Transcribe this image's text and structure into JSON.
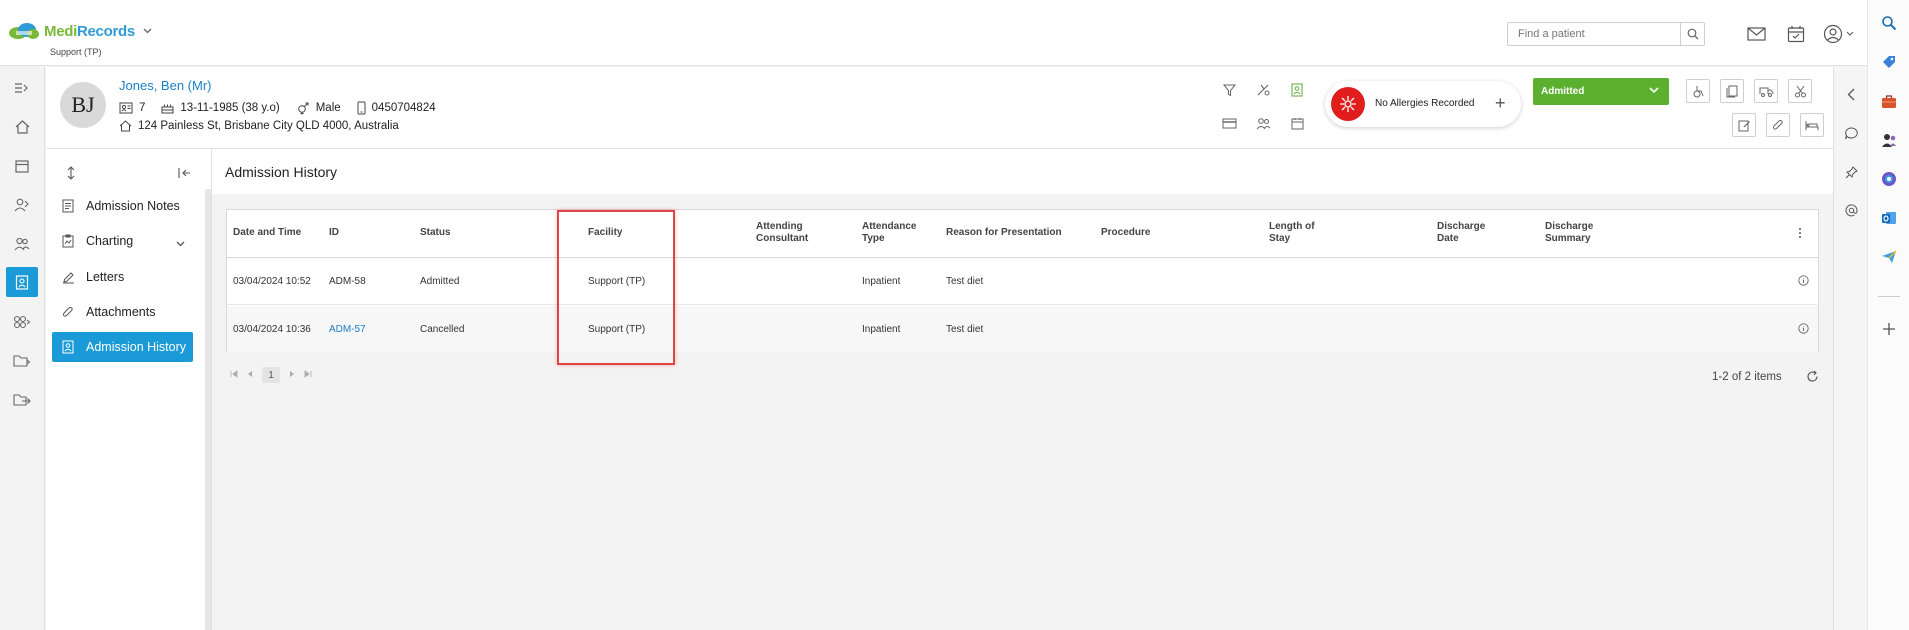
{
  "app": {
    "name_part1": "Medi",
    "name_part2": "Records",
    "facility": "Support (TP)"
  },
  "header": {
    "search_placeholder": "Find a patient"
  },
  "patient": {
    "initials": "BJ",
    "name": "Jones, Ben (Mr)",
    "id_number": "7",
    "dob": "13-11-1985 (38 y.o)",
    "gender": "Male",
    "phone": "0450704824",
    "address": "124 Painless St, Brisbane City QLD 4000, Australia",
    "allergy_text": "No Allergies Recorded",
    "allergy_add": "+",
    "admission_status": "Admitted"
  },
  "left_nav": {
    "items": [
      {
        "label": "Admission Notes",
        "icon": "document-icon"
      },
      {
        "label": "Charting",
        "icon": "chart-icon"
      },
      {
        "label": "Letters",
        "icon": "pencil-icon"
      },
      {
        "label": "Attachments",
        "icon": "paperclip-icon"
      },
      {
        "label": "Admission History",
        "icon": "history-icon"
      }
    ]
  },
  "main": {
    "title": "Admission History",
    "columns": [
      "Date and Time",
      "ID",
      "Status",
      "Facility",
      "Attending Consultant",
      "Attendance Type",
      "Reason for Presentation",
      "Procedure",
      "Length of Stay",
      "Discharge Date",
      "Discharge Summary"
    ],
    "columns_lines": {
      "attending": [
        "Attending",
        "Consultant"
      ],
      "attendance": [
        "Attendance",
        "Type"
      ],
      "length": [
        "Length of",
        "Stay"
      ],
      "discharge_date": [
        "Discharge",
        "Date"
      ],
      "discharge_summary": [
        "Discharge",
        "Summary"
      ]
    },
    "rows": [
      {
        "date": "03/04/2024 10:52",
        "id": "ADM-58",
        "status": "Admitted",
        "facility": "Support (TP)",
        "consultant": "",
        "type": "Inpatient",
        "reason": "Test diet",
        "procedure": "",
        "length": "",
        "discharge_date": "",
        "summary": ""
      },
      {
        "date": "03/04/2024 10:36",
        "id": "ADM-57",
        "status": "Cancelled",
        "facility": "Support (TP)",
        "consultant": "",
        "type": "Inpatient",
        "reason": "Test diet",
        "procedure": "",
        "length": "",
        "discharge_date": "",
        "summary": ""
      }
    ],
    "pager": {
      "page": "1",
      "info": "1-2 of 2 items"
    }
  },
  "colors": {
    "accent": "#1a9ad6",
    "link": "#1a7fc6",
    "admitted_green": "#5cb030",
    "allergy_red": "#e11d1d",
    "highlight": "#e04545"
  }
}
